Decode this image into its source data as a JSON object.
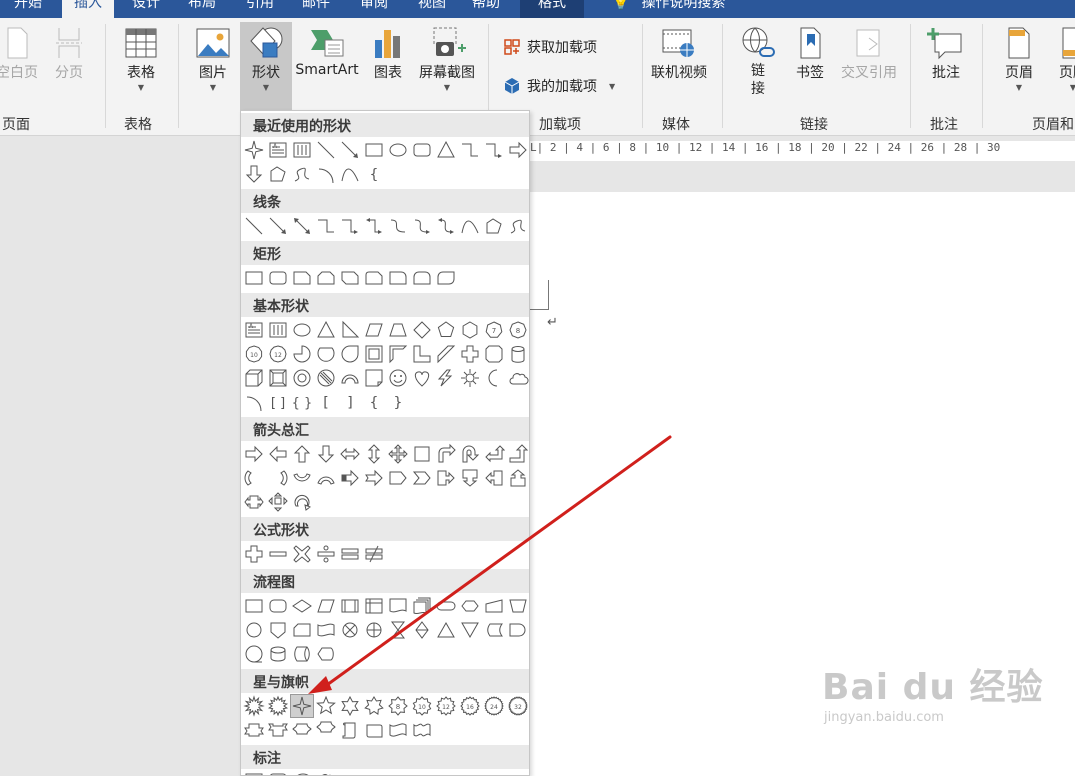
{
  "tabs": [
    {
      "label": "开始",
      "state": "normal"
    },
    {
      "label": "插入",
      "state": "active"
    },
    {
      "label": "设计",
      "state": "normal"
    },
    {
      "label": "布局",
      "state": "normal"
    },
    {
      "label": "引用",
      "state": "normal"
    },
    {
      "label": "邮件",
      "state": "normal"
    },
    {
      "label": "审阅",
      "state": "normal"
    },
    {
      "label": "视图",
      "state": "normal"
    },
    {
      "label": "帮助",
      "state": "normal"
    },
    {
      "label": "格式",
      "state": "contextual"
    },
    {
      "label": "操作说明搜索",
      "state": "search"
    }
  ],
  "ribbon": {
    "pages": {
      "blank_page": "空白页",
      "page_break": "分页",
      "group": "页面"
    },
    "tables": {
      "table": "表格",
      "group": "表格"
    },
    "illustrations": {
      "picture": "图片",
      "shapes": "形状",
      "smartart": "SmartArt",
      "chart": "图表",
      "screenshot": "屏幕截图"
    },
    "addins": {
      "get_addins": "获取加载项",
      "my_addins": "我的加载项",
      "group": "加载项"
    },
    "media": {
      "online_video": "联机视频",
      "group": "媒体"
    },
    "links": {
      "link": "链\n接",
      "bookmark": "书签",
      "cross_ref": "交叉引用",
      "group": "链接"
    },
    "comments": {
      "comment": "批注",
      "group": "批注"
    },
    "header_footer": {
      "header": "页眉",
      "footer": "页脚",
      "group": "页眉和"
    }
  },
  "colors": {
    "accent": "#2b579a",
    "arrow": "#d0201c",
    "selected": "#cfcfcf"
  },
  "ruler": "L|  2 |  4 |  6 |  8 | 10 | 12 | 14 | 16 | 18 | 20 | 22 | 24 | 26 | 28 | 30",
  "shapes_menu": {
    "categories": [
      {
        "name": "最近使用的形状",
        "icons": [
          "star4",
          "textbox",
          "vtextbox",
          "line",
          "arrow-line",
          "rect",
          "oval",
          "roundrect",
          "triangle",
          "elbow",
          "elbow-arrow",
          "right-arrow",
          "down-arrow",
          "freeform",
          "scribble",
          "arc",
          "curve",
          "brace-left"
        ]
      },
      {
        "name": "线条",
        "icons": [
          "line",
          "arrow-line",
          "dbl-arrow-line",
          "elbow",
          "elbow-arrow",
          "elbow-dbl",
          "curve-conn",
          "curve-conn-arrow",
          "curve-conn-dbl",
          "curve",
          "freeform",
          "scribble"
        ]
      },
      {
        "name": "矩形",
        "icons": [
          "rect",
          "roundrect",
          "snip1",
          "snip2",
          "snip-diag",
          "snipround",
          "round1",
          "round2",
          "round-diag"
        ]
      },
      {
        "name": "基本形状",
        "icons": [
          "textbox",
          "vtextbox",
          "oval",
          "triangle",
          "rtriangle",
          "parallelogram",
          "trapezoid",
          "diamond",
          "pentagon",
          "hexagon",
          "heptagon",
          "octagon",
          "decagon",
          "dodecagon",
          "pie",
          "chord",
          "teardrop",
          "frame",
          "halfframe",
          "lshape",
          "diagstripe",
          "cross",
          "plaque",
          "can",
          "cube",
          "bevel",
          "donut",
          "nosymbol",
          "blockarc",
          "foldedcorner",
          "smiley",
          "heart",
          "lightning",
          "sun",
          "moon",
          "cloud",
          "arc",
          "bracket-pair",
          "brace-pair",
          "bracket-left",
          "bracket-right",
          "brace-left",
          "brace-right"
        ]
      },
      {
        "name": "箭头总汇",
        "icons": [
          "right-arrow",
          "left-arrow",
          "up-arrow",
          "down-arrow",
          "lr-arrow",
          "ud-arrow",
          "quad-arrow",
          "lru-arrow",
          "bent-arrow",
          "uturn-arrow",
          "lu-arrow",
          "bentup-arrow",
          "curved-right",
          "curved-left",
          "curved-up",
          "curved-down",
          "striped-right",
          "notched-right",
          "pentagon-arrow",
          "chevron",
          "right-callout",
          "down-callout",
          "left-callout",
          "up-callout",
          "lr-callout",
          "quad-callout",
          "circular-arrow"
        ]
      },
      {
        "name": "公式形状",
        "icons": [
          "plus",
          "minus",
          "multiply",
          "divide",
          "equal",
          "notequal"
        ]
      },
      {
        "name": "流程图",
        "icons": [
          "process",
          "alt-process",
          "decision",
          "data",
          "predefined",
          "internal-storage",
          "document",
          "multidoc",
          "terminator",
          "preparation",
          "manual-input",
          "manual-op",
          "connector",
          "offpage",
          "card",
          "punched-tape",
          "summing",
          "or",
          "collate",
          "sort",
          "extract",
          "merge",
          "stored-data",
          "delay",
          "seq-storage",
          "magnetic-disk",
          "direct-storage",
          "display"
        ]
      },
      {
        "name": "星与旗帜",
        "icons": [
          "explosion1",
          "explosion2",
          "star4",
          "star5",
          "star6",
          "star7",
          "star8",
          "star10",
          "star12",
          "star16",
          "star24",
          "star32",
          "ribbon-up",
          "ribbon-down",
          "curved-ribbon-up",
          "curved-ribbon-down",
          "scroll-v",
          "scroll-h",
          "wave",
          "double-wave"
        ]
      },
      {
        "name": "标注",
        "icons": [
          "callout-rect",
          "callout-round",
          "callout-oval",
          "callout-cloud"
        ]
      }
    ],
    "selected_icon": "star4"
  },
  "watermark": {
    "main": "Bai du 经验",
    "sub": "jingyan.baidu.com"
  }
}
